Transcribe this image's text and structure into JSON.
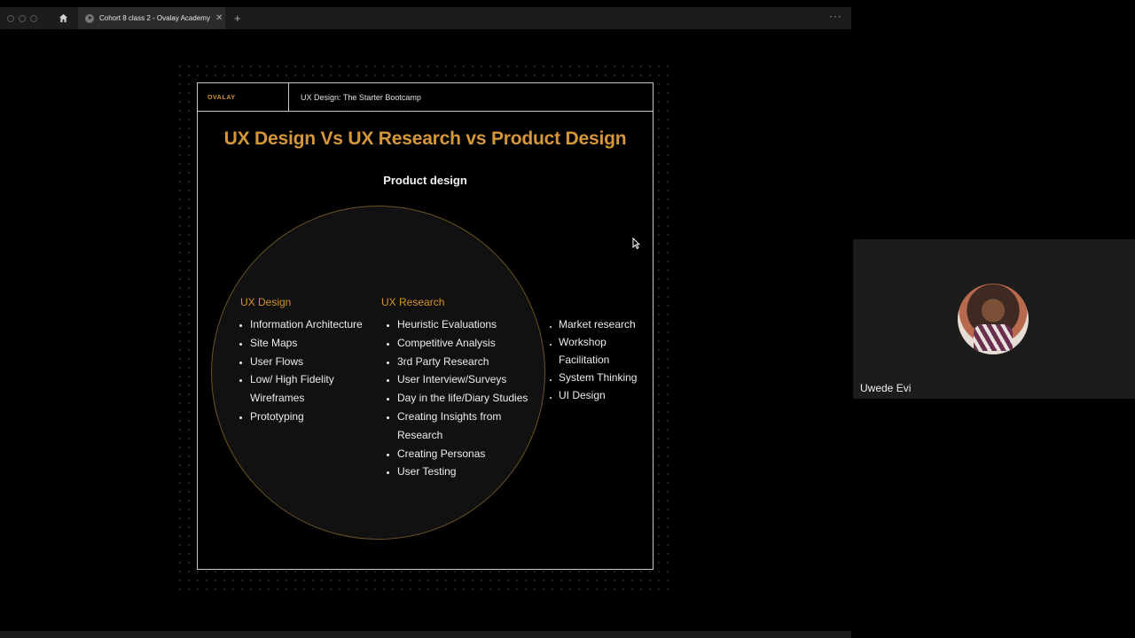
{
  "browser": {
    "tab_title": "Cohort 8 class 2 - Ovalay Academy",
    "new_tab": "+",
    "close": "✕",
    "more": "···"
  },
  "slide": {
    "logo": "OVALAY",
    "course": "UX Design: The Starter Bootcamp",
    "title": "UX Design Vs UX Research vs Product Design",
    "subtitle": "Product design",
    "ux_design": {
      "heading": "UX Design",
      "items": [
        "Information Architecture",
        "Site Maps",
        "User Flows",
        "Low/ High Fidelity Wireframes",
        "Prototyping"
      ]
    },
    "ux_research": {
      "heading": "UX Research",
      "items": [
        "Heuristic Evaluations",
        "Competitive Analysis",
        "3rd Party Research",
        "User Interview/Surveys",
        "Day in the life/Diary Studies",
        "Creating Insights from Research",
        "Creating Personas",
        "User Testing"
      ]
    },
    "product_design": {
      "items": [
        "Market research",
        "Workshop Facilitation",
        "System Thinking",
        "UI Design"
      ]
    }
  },
  "video": {
    "participant_name": "Uwede Evi"
  },
  "colors": {
    "accent": "#d4922f",
    "background": "#000000",
    "chrome": "#1c1c1c"
  }
}
